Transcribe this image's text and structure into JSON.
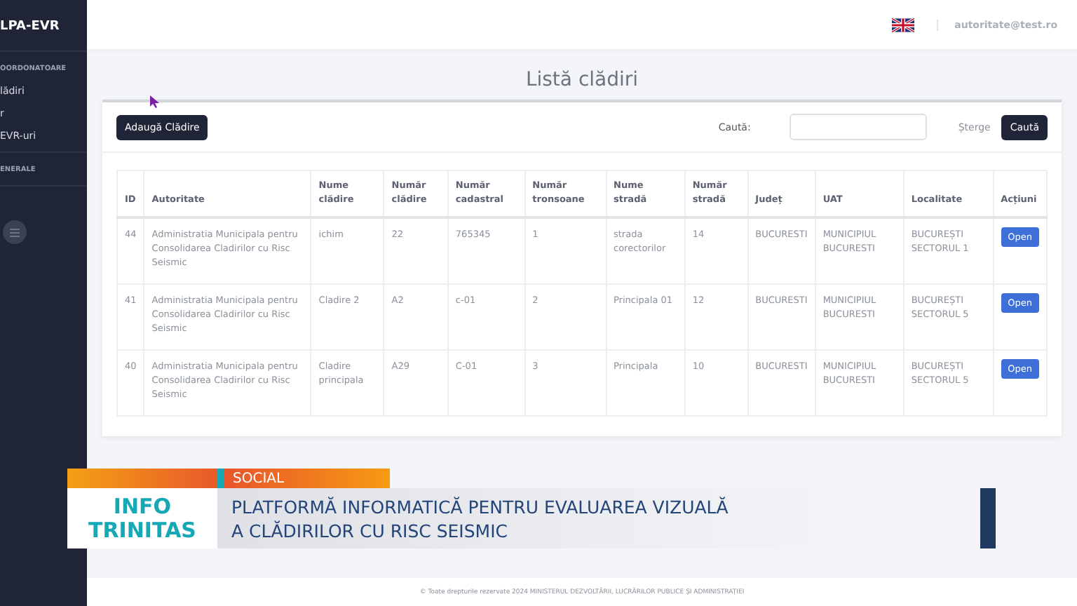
{
  "sidebar": {
    "brand": "LPA-EVR",
    "sections": [
      {
        "heading": "OORDONATOARE",
        "items": [
          {
            "label": "lădiri"
          },
          {
            "label": "r"
          },
          {
            "label": "EVR-uri"
          }
        ]
      },
      {
        "heading": "ENERALE"
      }
    ]
  },
  "topbar": {
    "user": "autoritate@test.ro"
  },
  "page": {
    "title": "Listă clădiri",
    "add_button": "Adaugă Clădire",
    "search": {
      "label": "Caută:",
      "clear": "Șterge",
      "button": "Caută"
    }
  },
  "table": {
    "columns": [
      "ID",
      "Autoritate",
      "Nume clădire",
      "Număr clădire",
      "Număr cadastral",
      "Număr tronsoane",
      "Nume stradă",
      "Număr stradă",
      "Județ",
      "UAT",
      "Localitate",
      "Acțiuni"
    ],
    "rows": [
      {
        "cells": [
          "44",
          "Administratia Municipala pentru Consolidarea Cladirilor cu Risc Seismic",
          "ichim",
          "22",
          "765345",
          "1",
          "strada corectorilor",
          "14",
          "BUCURESTI",
          "MUNICIPIUL BUCURESTI",
          "BUCUREȘTI SECTORUL 1"
        ],
        "action": "Open"
      },
      {
        "cells": [
          "41",
          "Administratia Municipala pentru Consolidarea Cladirilor cu Risc Seismic",
          "Cladire 2",
          "A2",
          "c-01",
          "2",
          "Principala 01",
          "12",
          "BUCURESTI",
          "MUNICIPIUL BUCURESTI",
          "BUCUREȘTI SECTORUL 5"
        ],
        "action": "Open"
      },
      {
        "cells": [
          "40",
          "Administratia Municipala pentru Consolidarea Cladirilor cu Risc Seismic",
          "Cladire principala",
          "A29",
          "C-01",
          "3",
          "Principala",
          "10",
          "BUCURESTI",
          "MUNICIPIUL BUCURESTI",
          "BUCUREȘTI SECTORUL 5"
        ],
        "action": "Open"
      }
    ]
  },
  "overlay": {
    "tag": "SOCIAL",
    "logo": [
      "INFO",
      "TRINITAS"
    ],
    "headline": [
      "PLATFORMĂ INFORMATICĂ PENTRU EVALUAREA VIZUALĂ",
      "A CLĂDIRILOR CU RISC SEISMIC"
    ]
  },
  "footer": "© Toate drepturile rezervate 2024 MINISTERUL DEZVOLTĂRII, LUCRĂRILOR PUBLICE ȘI ADMINISTRAȚIEI"
}
